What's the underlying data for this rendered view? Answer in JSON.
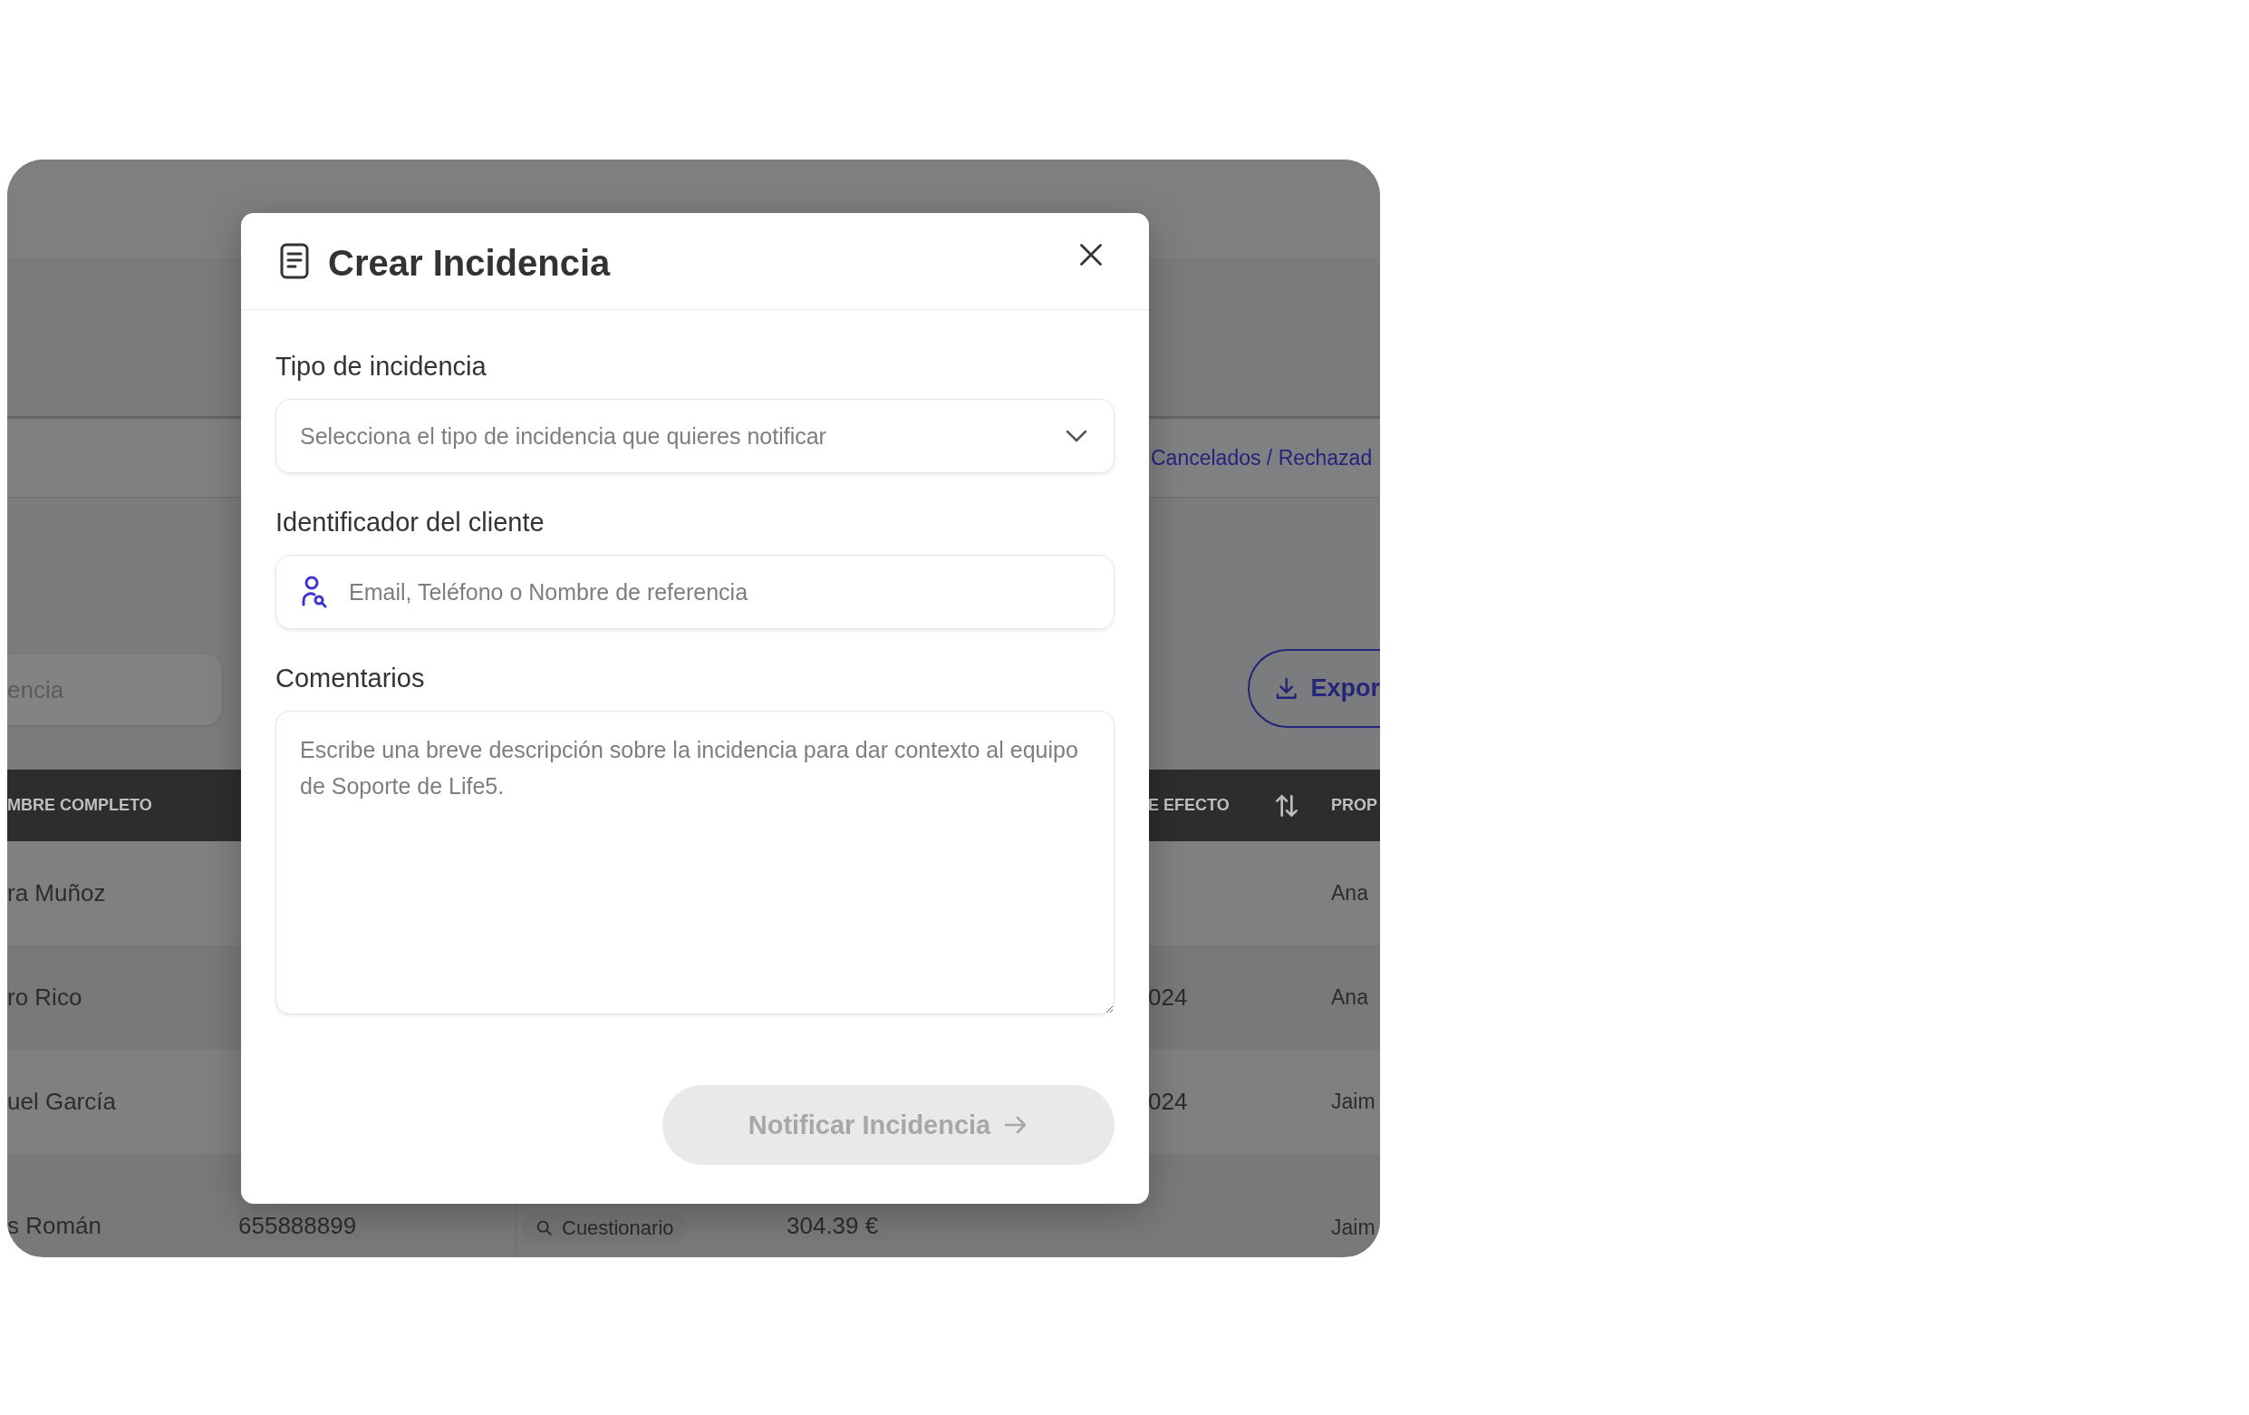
{
  "background": {
    "tab": "Cancelados / Rechazad",
    "search": {
      "value": "encia"
    },
    "export_button": "Expor",
    "table": {
      "columns": {
        "name": "MBRE COMPLETO",
        "effect": "E EFECTO",
        "owner": "PROP"
      },
      "rows": [
        {
          "name": "ra Muñoz",
          "owner": "Ana"
        },
        {
          "name": "ro Rico",
          "effect": "024",
          "owner": "Ana"
        },
        {
          "name": "uel García",
          "effect": "024",
          "owner": "Jaim"
        },
        {
          "name": "s Román",
          "phone": "655888899",
          "type": "Cuestionario",
          "amount": "304.39 €",
          "owner": "Jaim"
        }
      ]
    }
  },
  "modal": {
    "title": "Crear Incidencia",
    "fields": [
      {
        "kind": "select",
        "label": "Tipo de incidencia",
        "placeholder": "Selecciona el tipo de incidencia que quieres notificar"
      },
      {
        "kind": "input",
        "label": "Identificador del cliente",
        "placeholder": "Email, Teléfono o Nombre de referencia"
      },
      {
        "kind": "textarea",
        "label": "Comentarios",
        "placeholder": "Escribe una breve descripción sobre la incidencia para dar contexto al equipo de Soporte de Life5."
      }
    ],
    "submit": {
      "label": "Notificar Incidencia",
      "disabled": true
    }
  }
}
